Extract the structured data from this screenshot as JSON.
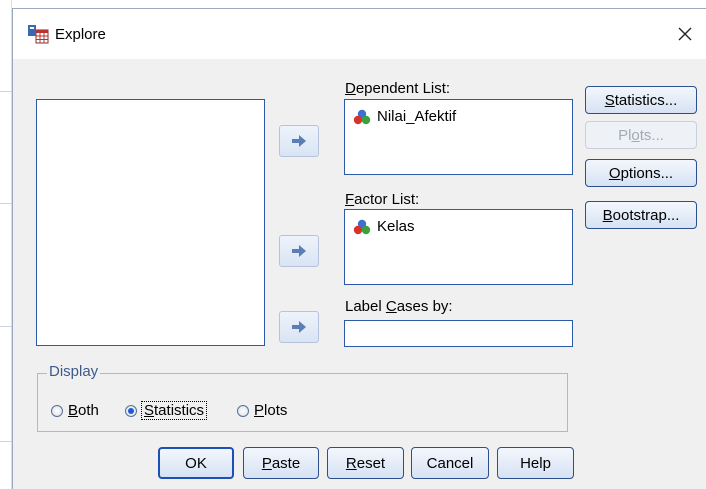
{
  "window": {
    "title": "Explore",
    "close_glyph": "✕"
  },
  "lists": {
    "dependent": {
      "label_before": "",
      "label_u": "D",
      "label_after": "ependent List:",
      "items": [
        "Nilai_Afektif"
      ]
    },
    "factor": {
      "label_u": "F",
      "label_after": "actor List:",
      "items": [
        "Kelas"
      ]
    },
    "label_cases": {
      "label_before": "Label ",
      "label_u": "C",
      "label_after": "ases by:",
      "value": ""
    }
  },
  "side_buttons": {
    "statistics": {
      "u": "S",
      "rest": "tatistics..."
    },
    "plots": {
      "before": "Pl",
      "u": "o",
      "rest": "ts..."
    },
    "options": {
      "u": "O",
      "rest": "ptions..."
    },
    "bootstrap": {
      "u": "B",
      "rest": "ootstrap..."
    }
  },
  "display": {
    "title": "Display",
    "options": [
      {
        "u": "B",
        "rest": "oth",
        "selected": false
      },
      {
        "u": "S",
        "rest": "tatistics",
        "selected": true
      },
      {
        "u": "P",
        "rest": "lots",
        "selected": false
      }
    ]
  },
  "bottom_buttons": {
    "ok": "OK",
    "paste": {
      "u": "P",
      "rest": "aste"
    },
    "reset": {
      "u": "R",
      "rest": "eset"
    },
    "cancel": "Cancel",
    "help": "Help"
  },
  "colors": {
    "accent": "#2b5aa8",
    "selected_radio": "#1d5bd6"
  },
  "icons": {
    "title": "explore-app-icon",
    "variable": "nominal-variable-icon",
    "arrow": "move-right-arrow-icon"
  }
}
